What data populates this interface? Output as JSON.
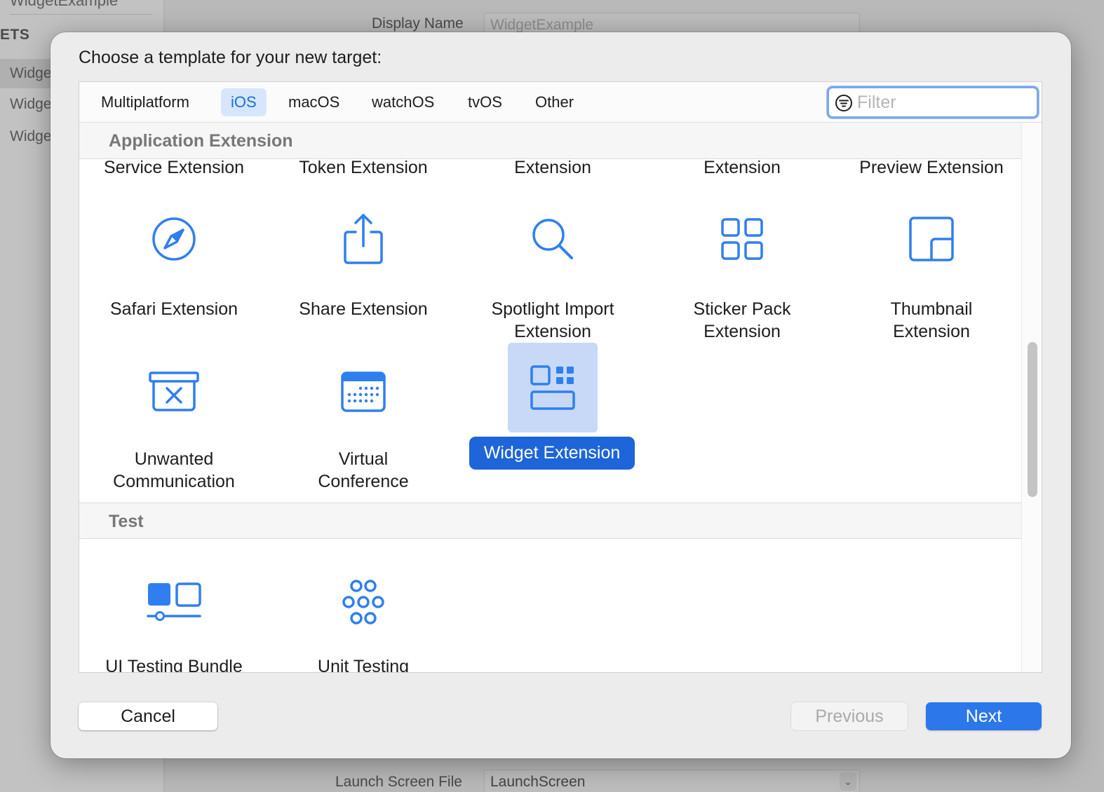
{
  "background": {
    "sidebar": {
      "title": "WidgetExample",
      "section": "ETS",
      "items": [
        "Widge",
        "Widge",
        "Widge"
      ]
    },
    "main": {
      "display_name_label": "Display Name",
      "display_name_placeholder": "WidgetExample",
      "launch_screen_label": "Launch Screen File",
      "launch_screen_value": "LaunchScreen"
    }
  },
  "dialog": {
    "title": "Choose a template for your new target:",
    "tabs": [
      {
        "label": "Multiplatform",
        "active": false
      },
      {
        "label": "iOS",
        "active": true
      },
      {
        "label": "macOS",
        "active": false
      },
      {
        "label": "watchOS",
        "active": false
      },
      {
        "label": "tvOS",
        "active": false
      },
      {
        "label": "Other",
        "active": false
      }
    ],
    "filter": {
      "placeholder": "Filter",
      "value": ""
    },
    "sections": [
      {
        "title": "Application Extension",
        "partial_row": [
          "Service Extension",
          "Token Extension",
          "Extension",
          "Extension",
          "Preview Extension"
        ],
        "items": [
          {
            "label": "Safari Extension",
            "icon": "compass-icon"
          },
          {
            "label": "Share Extension",
            "icon": "share-icon"
          },
          {
            "label": "Spotlight Import\nExtension",
            "icon": "magnifier-icon"
          },
          {
            "label": "Sticker Pack\nExtension",
            "icon": "grid-icon"
          },
          {
            "label": "Thumbnail\nExtension",
            "icon": "thumbnail-icon"
          },
          {
            "label": "Unwanted\nCommunication",
            "icon": "junk-tray-icon"
          },
          {
            "label": "Virtual\nConference",
            "icon": "calendar-icon"
          },
          {
            "label": "Widget Extension",
            "icon": "widget-icon",
            "selected": true
          }
        ]
      },
      {
        "title": "Test",
        "items": [
          {
            "label": "UI Testing Bundle",
            "icon": "ui-testing-icon"
          },
          {
            "label": "Unit Testing\nBundle",
            "icon": "unit-testing-icon"
          }
        ]
      }
    ],
    "buttons": {
      "cancel": "Cancel",
      "previous": "Previous",
      "next": "Next"
    },
    "colors": {
      "accent": "#2c77e9",
      "selection_label": "#1d65d8",
      "selection_tile": "#c7d9f6",
      "icon_blue": "#2f7ff0"
    }
  }
}
